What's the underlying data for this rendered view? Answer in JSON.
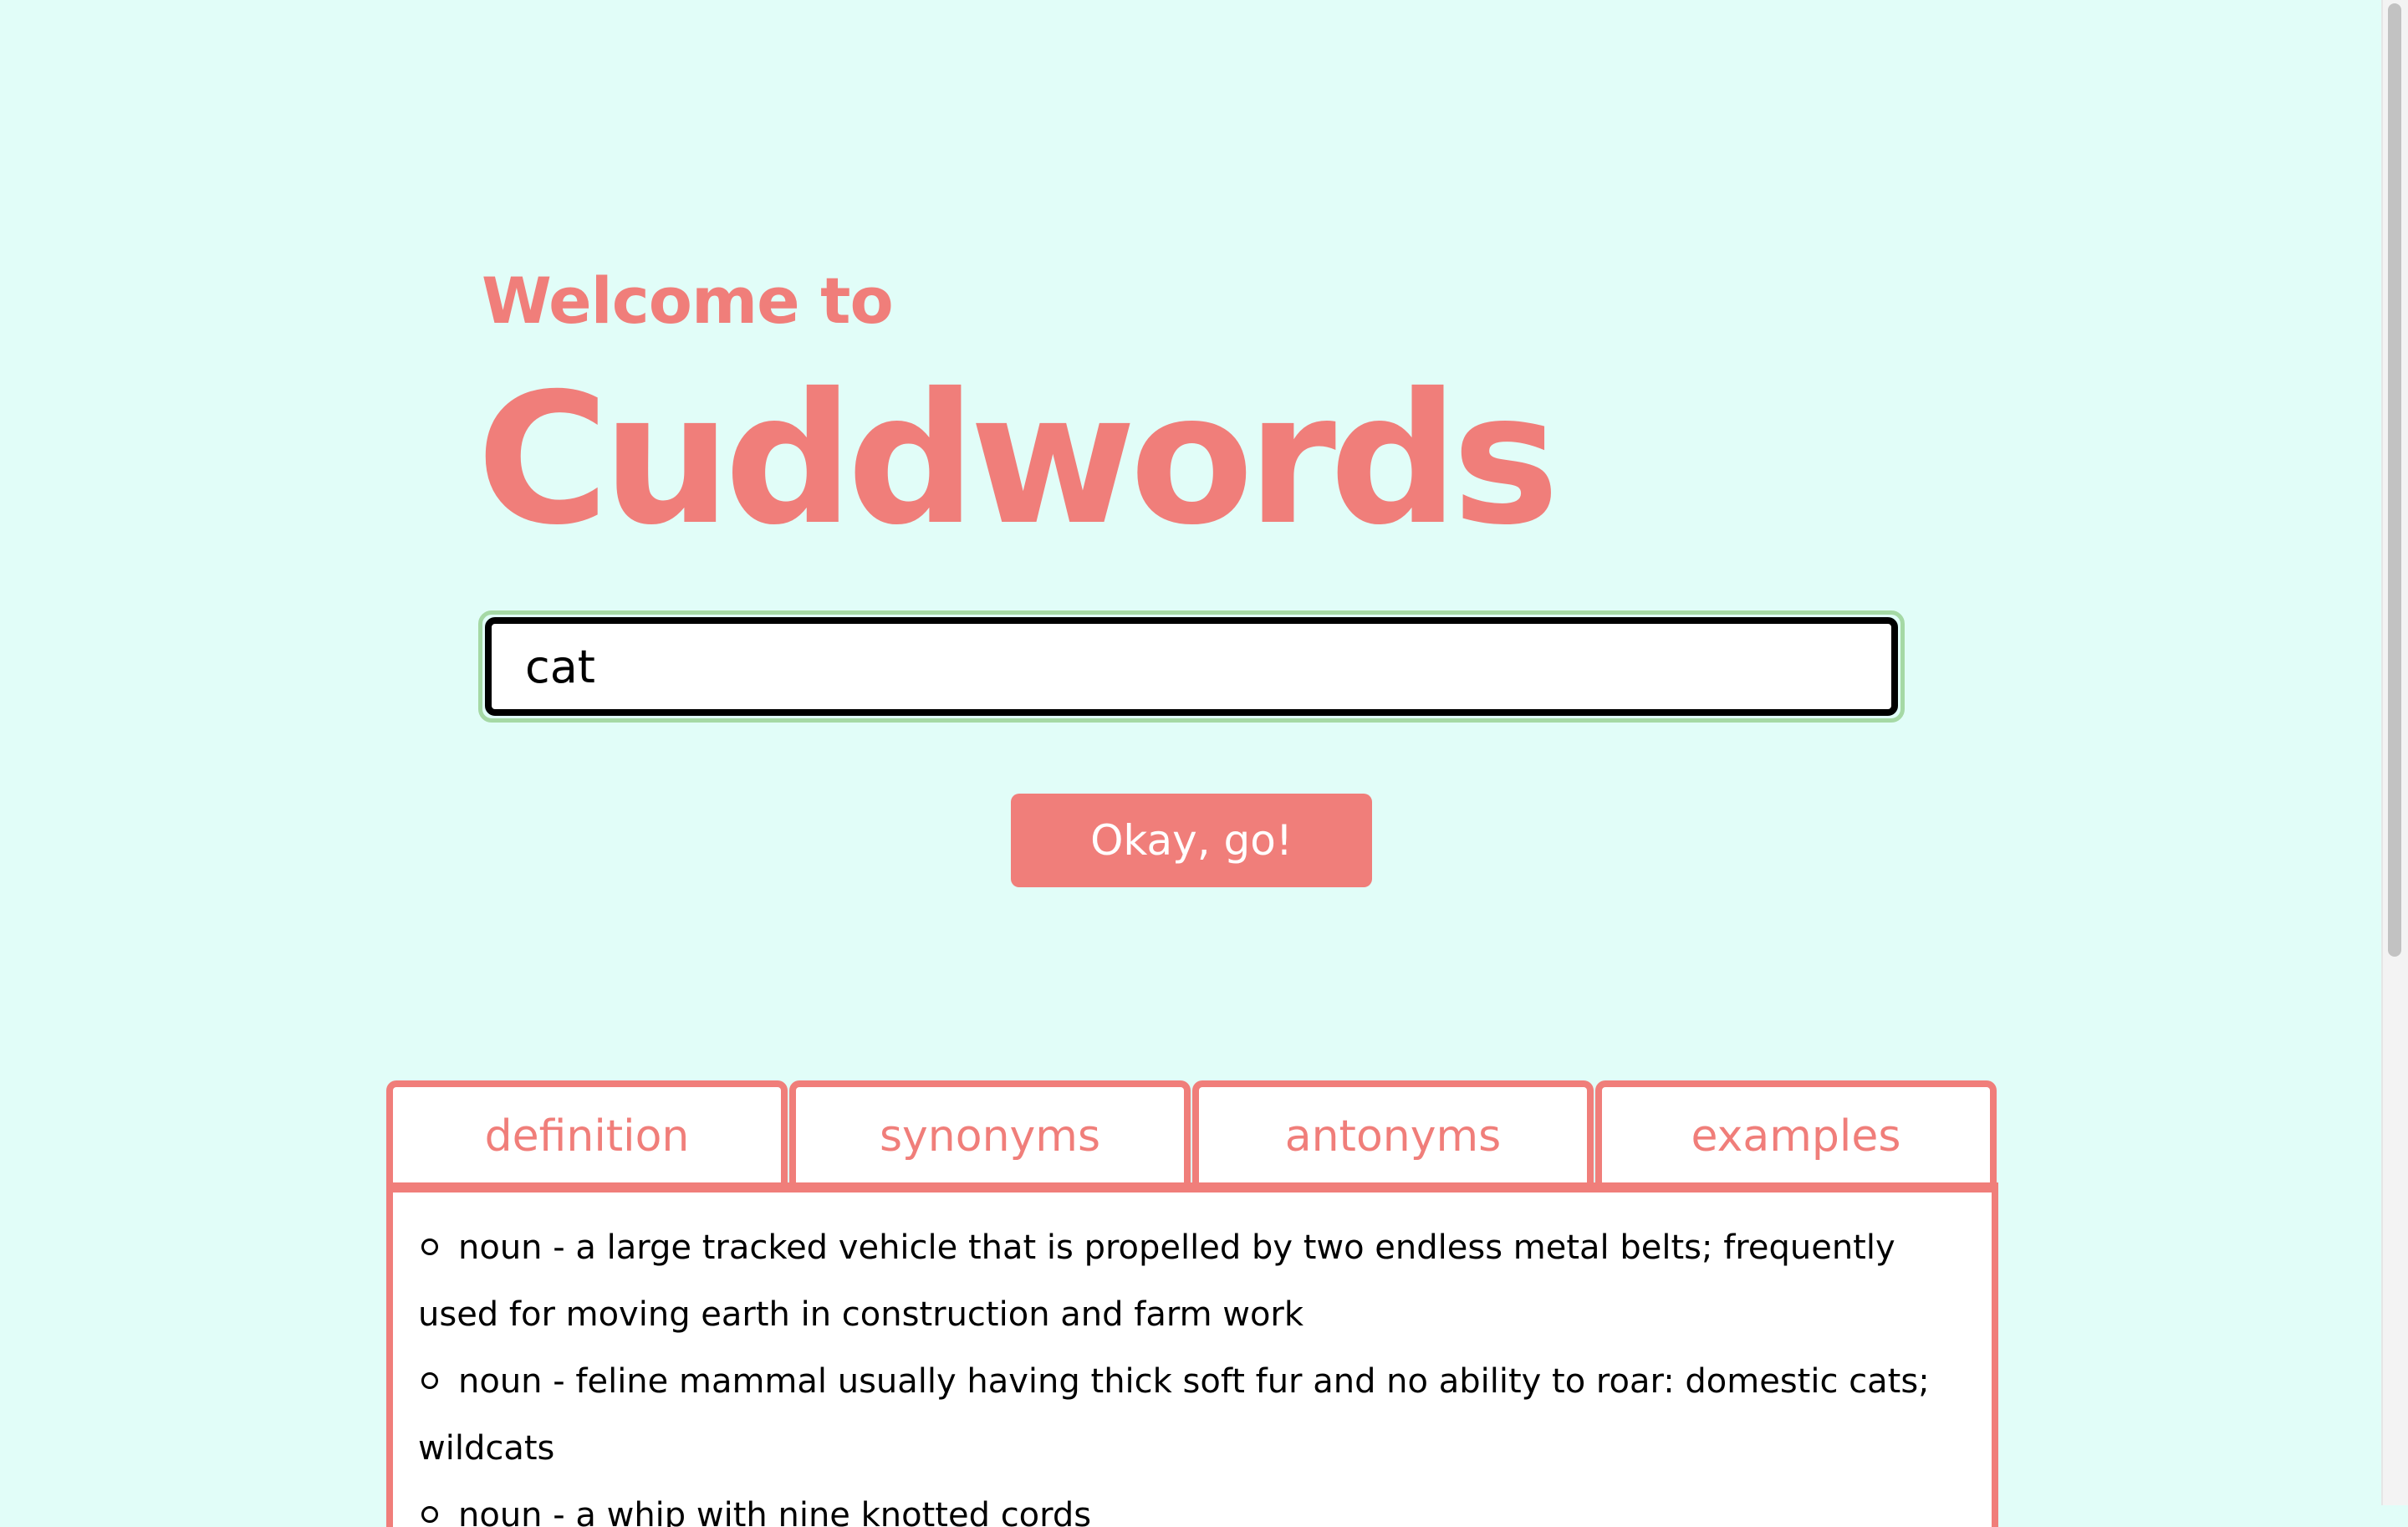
{
  "header": {
    "welcome": "Welcome to",
    "brand": "Cuddwords"
  },
  "search": {
    "value": "cat",
    "button_label": "Okay, go!"
  },
  "tabs": [
    {
      "label": "definition"
    },
    {
      "label": "synonyms"
    },
    {
      "label": "antonyms"
    },
    {
      "label": "examples"
    }
  ],
  "results": [
    {
      "text": "noun - a large tracked vehicle that is propelled by two endless metal belts; frequently used for moving earth in construction and farm work"
    },
    {
      "text": "noun - feline mammal usually having thick soft fur and no ability to roar: domestic cats; wildcats"
    },
    {
      "text": "noun - a whip with nine knotted cords"
    }
  ],
  "colors": {
    "background": "#e1fdf8",
    "accent": "#f07e7a",
    "focus_ring": "#a5d9a5"
  }
}
